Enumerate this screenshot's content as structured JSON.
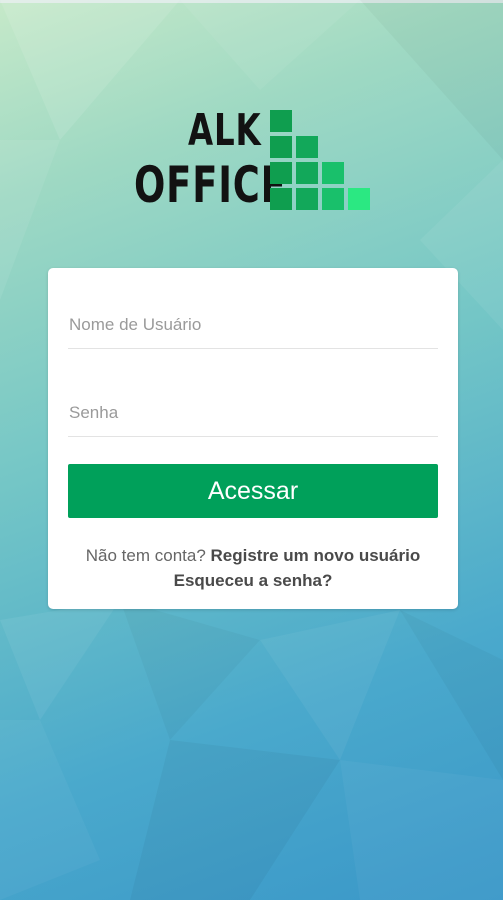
{
  "colors": {
    "accent": "#00a05a",
    "logo_text": "#121212",
    "card_bg": "#ffffff",
    "link_text": "#4a4a4a"
  },
  "logo": {
    "line1": "ALK",
    "line2": "OFFICE"
  },
  "login": {
    "username_placeholder": "Nome de Usuário",
    "password_placeholder": "Senha",
    "submit_label": "Acessar",
    "register_prompt": "Não tem conta?",
    "register_link": "Registre um novo usuário",
    "forgot_link": "Esqueceu a senha?"
  }
}
